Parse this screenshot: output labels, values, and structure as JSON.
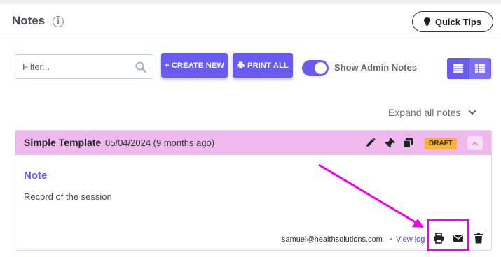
{
  "header": {
    "title": "Notes",
    "info_icon": "info-circle-icon",
    "quick_tips_label": "Quick Tips"
  },
  "toolbar": {
    "filter_placeholder": "Filter...",
    "filter_value": "",
    "create_new_label": "+ CREATE NEW",
    "print_all_label": "PRINT ALL",
    "show_admin_notes_label": "Show Admin Notes",
    "show_admin_notes_on": true,
    "views": [
      "list-view-icon",
      "grid-view-icon"
    ]
  },
  "expand_all_label": "Expand all notes",
  "note": {
    "template_name": "Simple Template",
    "date": "05/04/2024 (9 months ago)",
    "status_badge": "DRAFT",
    "label": "Note",
    "body": "Record of the session",
    "author": "samuel@healthsolutions.com",
    "separator": "•",
    "view_log_label": "View log",
    "header_icons": [
      "pencil-icon",
      "pin-icon",
      "copy-icon"
    ],
    "footer_icons": [
      "print-icon",
      "envelope-icon",
      "trash-icon"
    ]
  },
  "colors": {
    "accent": "#6a5bf0",
    "note_header_bg": "#f0b9ee",
    "draft_badge": "#f9b233",
    "annotation": "#f000f0"
  }
}
